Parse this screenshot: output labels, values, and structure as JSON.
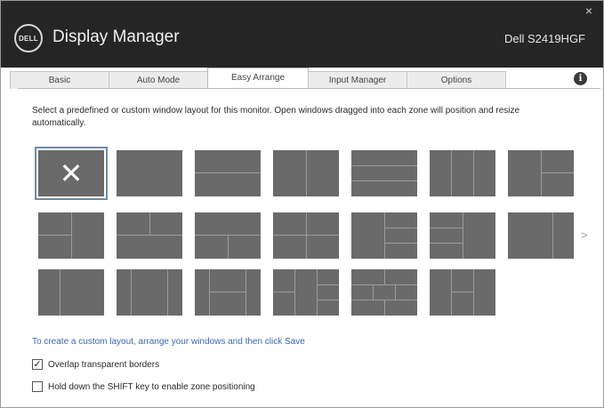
{
  "window": {
    "logo_text": "DELL",
    "app_title": "Display Manager",
    "monitor_name": "Dell S2419HGF",
    "close_glyph": "×"
  },
  "tabs": [
    {
      "label": "Basic",
      "active": false
    },
    {
      "label": "Auto Mode",
      "active": false
    },
    {
      "label": "Easy Arrange",
      "active": true
    },
    {
      "label": "Input Manager",
      "active": false
    },
    {
      "label": "Options",
      "active": false
    }
  ],
  "info_glyph": "i",
  "instructions": "Select a predefined or custom window layout for this monitor. Open windows dragged into each zone will position and resize automatically.",
  "layouts": {
    "count": 20,
    "selected_index": 0,
    "selected_glyph": "✕",
    "next_glyph": ">"
  },
  "custom_text": "To create a custom layout, arrange your windows and then click",
  "custom_link": "Save",
  "options": [
    {
      "label": "Overlap transparent borders",
      "checked": true
    },
    {
      "label": "Hold down the SHIFT key to enable zone positioning",
      "checked": false
    }
  ],
  "check_glyph": "✓"
}
